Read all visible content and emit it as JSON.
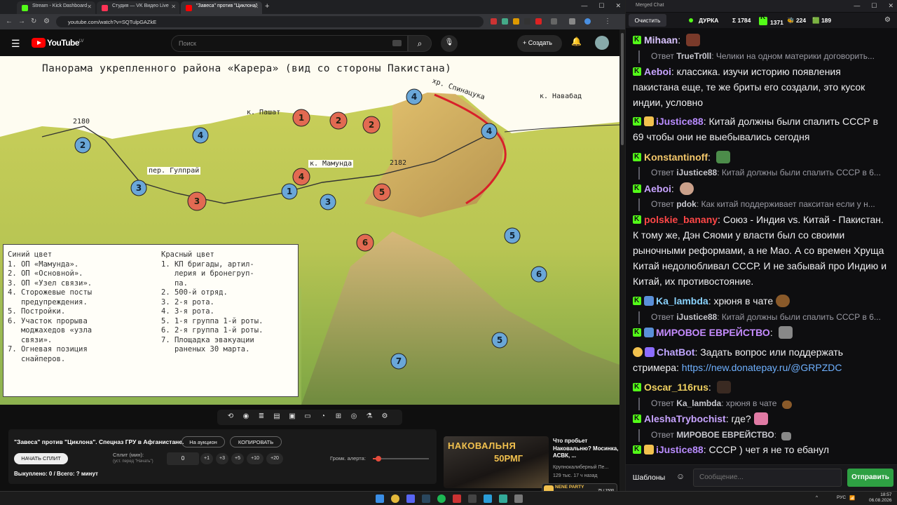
{
  "browser": {
    "tabs": [
      {
        "label": "Stream - Kick Dashboard",
        "color": "#53fc18"
      },
      {
        "label": "Студия — VK Видео Live",
        "color": "#ff3355"
      },
      {
        "label": "\"Завеса\" против \"Циклона\"",
        "color": "#ff0000"
      }
    ],
    "url": "youtube.com/watch?v=SQTulpGAZkE"
  },
  "youtube": {
    "logo_text": "YouTube",
    "region": "LV",
    "search_placeholder": "Поиск",
    "create_label": "Создать"
  },
  "map": {
    "title": "Панорама укрепленного района «Карера» (вид со стороны Пакистана)",
    "labels": {
      "pashat": "к. Пашат",
      "navabad": "к. Навабад",
      "spinatsuka": "хр. Спинацука",
      "gulprai": "пер. Гулпрай",
      "mamunda": "к. Мамунда",
      "h2180": "2180",
      "h2182": "2182"
    },
    "legend": {
      "blue_title": "Синий цвет",
      "blue_items": "1. ОП «Мамунда».\n2. ОП «Основной».\n3. ОП «Узел связи».\n4. Сторожевые посты\n   предупреждения.\n5. Постройки.\n6. Участок прорыва\n   моджахедов «узла\n   связи».\n7. Огневая позиция\n   снайперов.",
      "red_title": "Красный цвет",
      "red_items": "1. КП бригады, артил-\n   лерия и бронегруп-\n   па.\n2. 500-й отряд.\n3. 2-я рота.\n4. 3-я рота.\n5. 1-я группа 1-й роты.\n6. 2-я группа 1-й роты.\n7. Площадка эвакуации\n   раненых 30 марта."
    }
  },
  "panel": {
    "video_title": "\"Завеса\" против \"Циклона\". Спецназ ГРУ в Афганистане.",
    "auction_btn": "На аукцион",
    "copy_btn": "КОПИРОВАТЬ",
    "start_split": "НАЧАТЬ СПЛИТ",
    "split_label": "Сплит (мин):",
    "split_hint": "(уст. перед \"Начать\")",
    "split_value": "0",
    "increments": [
      "+1",
      "+3",
      "+5",
      "+10",
      "+20"
    ],
    "volume_label": "Громк. алерта:",
    "volume_level": 0.1,
    "bought": "Выкуплено: 0 / Всего: ? минут"
  },
  "recommendation": {
    "thumb_text1": "НАКОВАЛЬНЯ",
    "thumb_text2": "50РМГ",
    "title": "Что пробьет Наковальню? Мосинка, АСВК, ...",
    "channel": "Крупнокалиберный Пе...",
    "meta": "129 тыс.   17 ч назад"
  },
  "nene": {
    "title": "NENE PARTY",
    "progress": "75 / 1500"
  },
  "chat": {
    "window_title": "Merged Chat",
    "clear_btn": "Очистить",
    "channel": "ДУРКА",
    "total": "Σ 1784",
    "kick_count": "1371",
    "count2": "224",
    "count3": "189",
    "messages": [
      {
        "user": "Mihaan",
        "color": "#d9c3ff",
        "text": "",
        "reply_user": "TrueTr0ll",
        "reply_text": "Челики на одном материки договорить..."
      },
      {
        "user": "Aeboi",
        "color": "#c7a3ff",
        "text": "классика. изучи историю появления пакистана еще, те же бриты его создали, это кусок индии, условно"
      },
      {
        "user": "iJustice88",
        "color": "#b98cff",
        "text": "Китай должны были спалить СССР в 69 чтобы они не выебывались сегодня"
      },
      {
        "user": "Konstantinoff",
        "color": "#f3c76a",
        "text": "",
        "reply_user": "iJustice88",
        "reply_text": "Китай должны были спалить СССР в 6..."
      },
      {
        "user": "Aeboi",
        "color": "#c7a3ff",
        "text": "",
        "reply_user": "pdok",
        "reply_text": "Как китай поддерживает пакситан если у н..."
      },
      {
        "user": "polskie_banany",
        "color": "#ff4747",
        "text": "Союз - Индия vs. Китай - Пакистан. К тому же, Дэн Сяоми у власти был со своими рыночными реформами, а не Мао. А со времен Хруща Китай недолюбливал СССР. И не забывай про Индию и Китай, их противостояние."
      },
      {
        "user": "Ka_lambda",
        "color": "#8ad3ff",
        "text": "хрюня в чате",
        "reply_user": "iJustice88",
        "reply_text": "Китай должны были спалить СССР в 6..."
      },
      {
        "user": "МИРОВОЕ ЕВРЕЙСТВО",
        "color": "#c58cff",
        "text": ""
      },
      {
        "user": "ChatBot",
        "color": "#c0a6ff",
        "text": "Задать вопрос или поддержать стримера:",
        "link": "https://new.donatepay.ru/@GRPZDC"
      },
      {
        "user": "Oscar_116rus",
        "color": "#f0d060",
        "text": "",
        "reply_user": "Ka_lambda",
        "reply_text": "хрюня в чате"
      },
      {
        "user": "AleshaTrybochist",
        "color": "#c7a3ff",
        "text": "где?",
        "reply_user": "МИРОВОЕ ЕВРЕЙСТВО",
        "reply_text": ""
      },
      {
        "user": "iJustice88",
        "color": "#b98cff",
        "text": "СССР ) чет я не то ебанул"
      }
    ],
    "reply_label": "Ответ",
    "templates_btn": "Шаблоны",
    "input_placeholder": "Сообщение...",
    "send_btn": "Отправить"
  },
  "taskbar": {
    "lang": "РУС",
    "time": "18:57",
    "date": "06.08.2026"
  }
}
